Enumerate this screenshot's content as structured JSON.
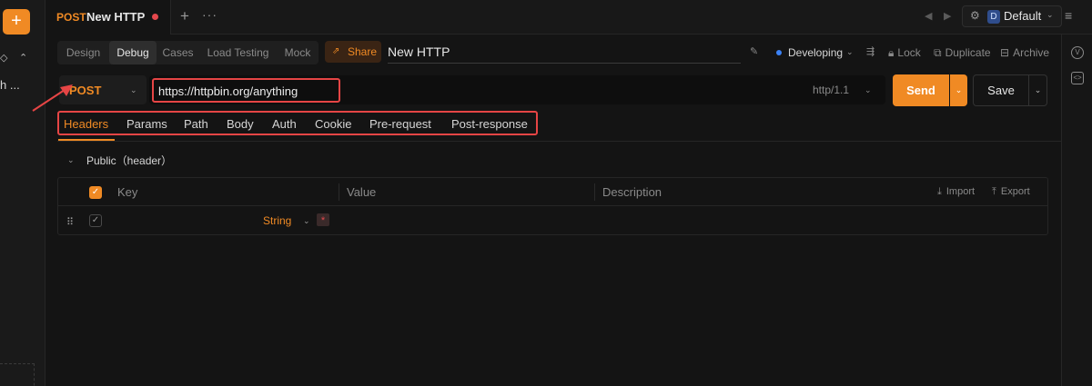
{
  "sidebar": {
    "new_label": "+",
    "glyph_a": "◇",
    "glyph_b": "⌃",
    "truncated_item": "h ..."
  },
  "tab": {
    "method": "POST",
    "title": "New HTTP",
    "add": "+",
    "more": "···"
  },
  "env": {
    "badge": "D",
    "name": "Default"
  },
  "modes": [
    "Design",
    "Debug",
    "Cases",
    "Load Testing",
    "Mock"
  ],
  "share_label": "Share",
  "api_name": "New HTTP",
  "status": "Developing",
  "actions": {
    "lock": "Lock",
    "duplicate": "Duplicate",
    "archive": "Archive"
  },
  "request": {
    "method": "POST",
    "url": "https://httpbin.org/anything",
    "protocol": "http/1.1",
    "send": "Send",
    "save": "Save"
  },
  "param_tabs": [
    "Headers",
    "Params",
    "Path",
    "Body",
    "Auth",
    "Cookie",
    "Pre-request",
    "Post-response"
  ],
  "public_header": "Public（header）",
  "table": {
    "columns": [
      "Key",
      "Value",
      "Description"
    ],
    "import": "Import",
    "export": "Export",
    "row": {
      "type": "String",
      "required_mark": "*"
    }
  },
  "colors": {
    "accent": "#f08a24",
    "annotation": "#e64545",
    "status_dot": "#3b82f6"
  }
}
